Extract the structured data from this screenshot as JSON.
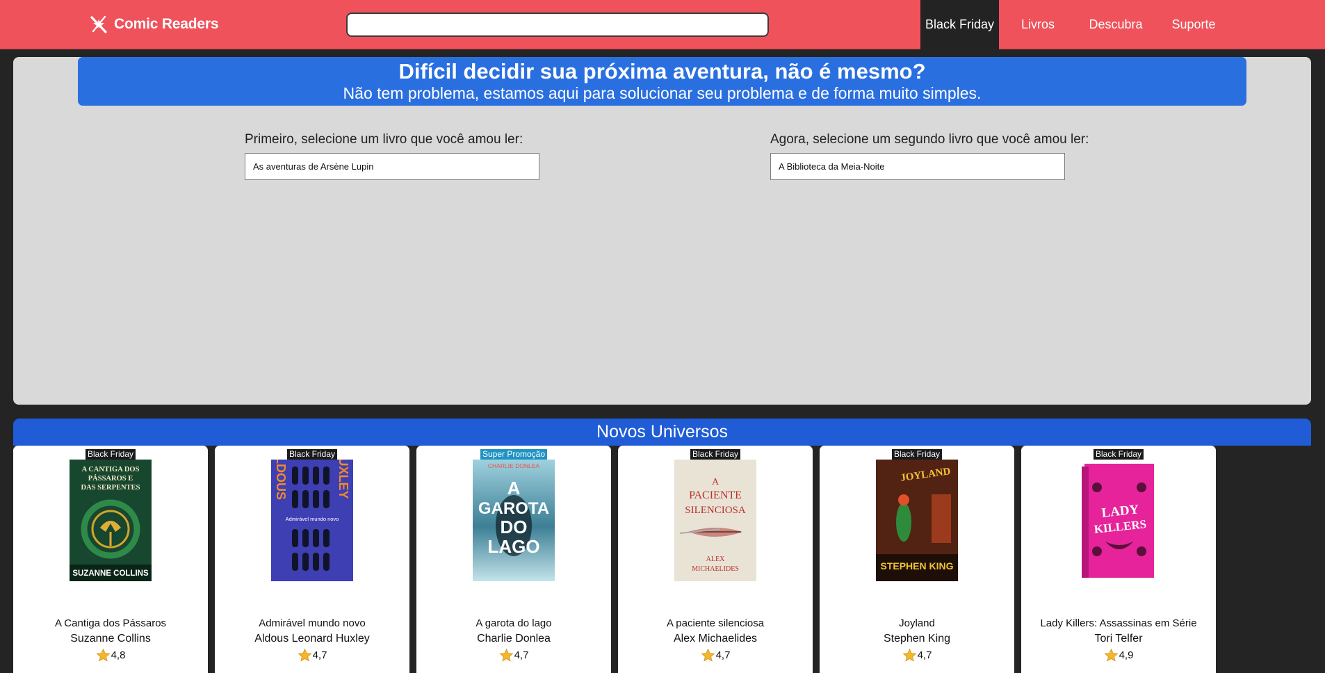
{
  "header": {
    "brand_name": "Comic Readers",
    "search_placeholder": "",
    "nav": [
      "Black Friday",
      "Livros",
      "Descubra",
      "Suporte"
    ],
    "active_nav": "Black Friday",
    "colors": {
      "bar": "#ef525b",
      "active_tab": "#232323"
    }
  },
  "hero": {
    "title": "Difícil decidir sua próxima aventura, não é mesmo?",
    "subtitle": "Não tem problema, estamos aqui para solucionar seu problema e de forma muito simples.",
    "picker_1": {
      "label": "Primeiro, selecione um livro que você amou ler:",
      "value": "As aventuras de Arsène Lupin"
    },
    "picker_2": {
      "label": "Agora, selecione um segundo livro que você amou ler:",
      "value": "A Biblioteca da Meia-Noite"
    },
    "colors": {
      "banner": "#2a6fe0",
      "panel": "#d9d9d9"
    }
  },
  "novos_universos": {
    "heading": "Novos Universos",
    "books": [
      {
        "badge": "Black Friday",
        "title": "A Cantiga dos Pássaros",
        "author": "Suzanne Collins",
        "rating": "4,8",
        "cover": {
          "lines": [
            "A CANTIGA DOS",
            "PÁSSAROS E",
            "DAS SERPENTES"
          ],
          "footer": "SUZANNE COLLINS"
        }
      },
      {
        "badge": "Black Friday",
        "title": "Admirável mundo novo",
        "author": "Aldous Leonard Huxley",
        "rating": "4,7",
        "cover": {
          "left": "ALDOUS",
          "right": "HUXLEY",
          "center": "Admirável mundo novo"
        }
      },
      {
        "badge": "Super Promoção",
        "title": "A garota do lago",
        "author": "Charlie Donlea",
        "rating": "4,7",
        "cover": {
          "top": "CHARLIE DONLEA",
          "lines": [
            "A",
            "GAROTA",
            "DO",
            "LAGO"
          ]
        }
      },
      {
        "badge": "Black Friday",
        "title": "A paciente silenciosa",
        "author": "Alex Michaelides",
        "rating": "4,7",
        "cover": {
          "lines": [
            "A",
            "PACIENTE",
            "SILENCIOSA"
          ],
          "footer": [
            "ALEX",
            "MICHAELIDES"
          ]
        }
      },
      {
        "badge": "Black Friday",
        "title": "Joyland",
        "author": "Stephen King",
        "rating": "4,7",
        "cover": {
          "top": "JOYLAND",
          "footer": "STEPHEN KING"
        }
      },
      {
        "badge": "Black Friday",
        "title": "Lady Killers: Assassinas em Série",
        "author": "Tori Telfer",
        "rating": "4,9",
        "cover": {
          "lines": [
            "LADY",
            "KILLERS"
          ]
        }
      }
    ]
  }
}
